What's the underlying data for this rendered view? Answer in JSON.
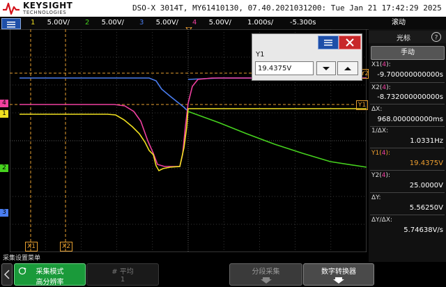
{
  "header": {
    "brand": "KEYSIGHT",
    "brand_sub": "TECHNOLOGIES",
    "model_line": "DSO-X 3014T, MY61410130, 07.40.2021031200: Tue Jan 21 17:42:29 2025"
  },
  "channels": [
    {
      "num": "1",
      "scale": "5.00V/",
      "color": "#f0e020"
    },
    {
      "num": "2",
      "scale": "5.00V/",
      "color": "#46d21e"
    },
    {
      "num": "3",
      "scale": "5.00V/",
      "color": "#4a7df0"
    },
    {
      "num": "4",
      "scale": "5.00V/",
      "color": "#f040a0"
    }
  ],
  "timebase": {
    "scale": "1.000s/",
    "delay": "-5.300s"
  },
  "run_state": "滚动",
  "side_panel": {
    "title": "光标",
    "mode_button": "手动",
    "x1_label": "X1(",
    "x1_src": "4",
    "x1_value": "-9.700000000000s",
    "x2_label": "X2(",
    "x2_src": "4",
    "x2_value": "-8.732000000000s",
    "dx_label": "ΔX:",
    "dx_value": "968.000000000ms",
    "inv_dx_label": "1/ΔX:",
    "inv_dx_value": "1.0331Hz",
    "y1_label": "Y1(",
    "y1_src": "4",
    "y1_value": "19.4375V",
    "y2_label": "Y2(",
    "y2_src": "4",
    "y2_value": "25.0000V",
    "dy_label": "ΔY:",
    "dy_value": "5.56250V",
    "dydx_label": "ΔY/ΔX:",
    "dydx_value": "5.74638V/s",
    "src_close": ")",
    "colon": ":"
  },
  "popup": {
    "label": "Y1",
    "value": "19.4375V"
  },
  "markers": {
    "x1": "X1",
    "x2": "X2",
    "y1": "Y1",
    "y2": "Y2",
    "ch4": "4",
    "ch1": "1",
    "ch3": "3",
    "ch2": "2"
  },
  "bottom_menu": {
    "title": "采集设置菜单",
    "acq_mode_label": "采集模式",
    "acq_mode_value": "高分辨率",
    "avg_label": "# 平均",
    "avg_value": "1",
    "segment_label": "分段采集",
    "digital_label": "数字转换器"
  }
}
